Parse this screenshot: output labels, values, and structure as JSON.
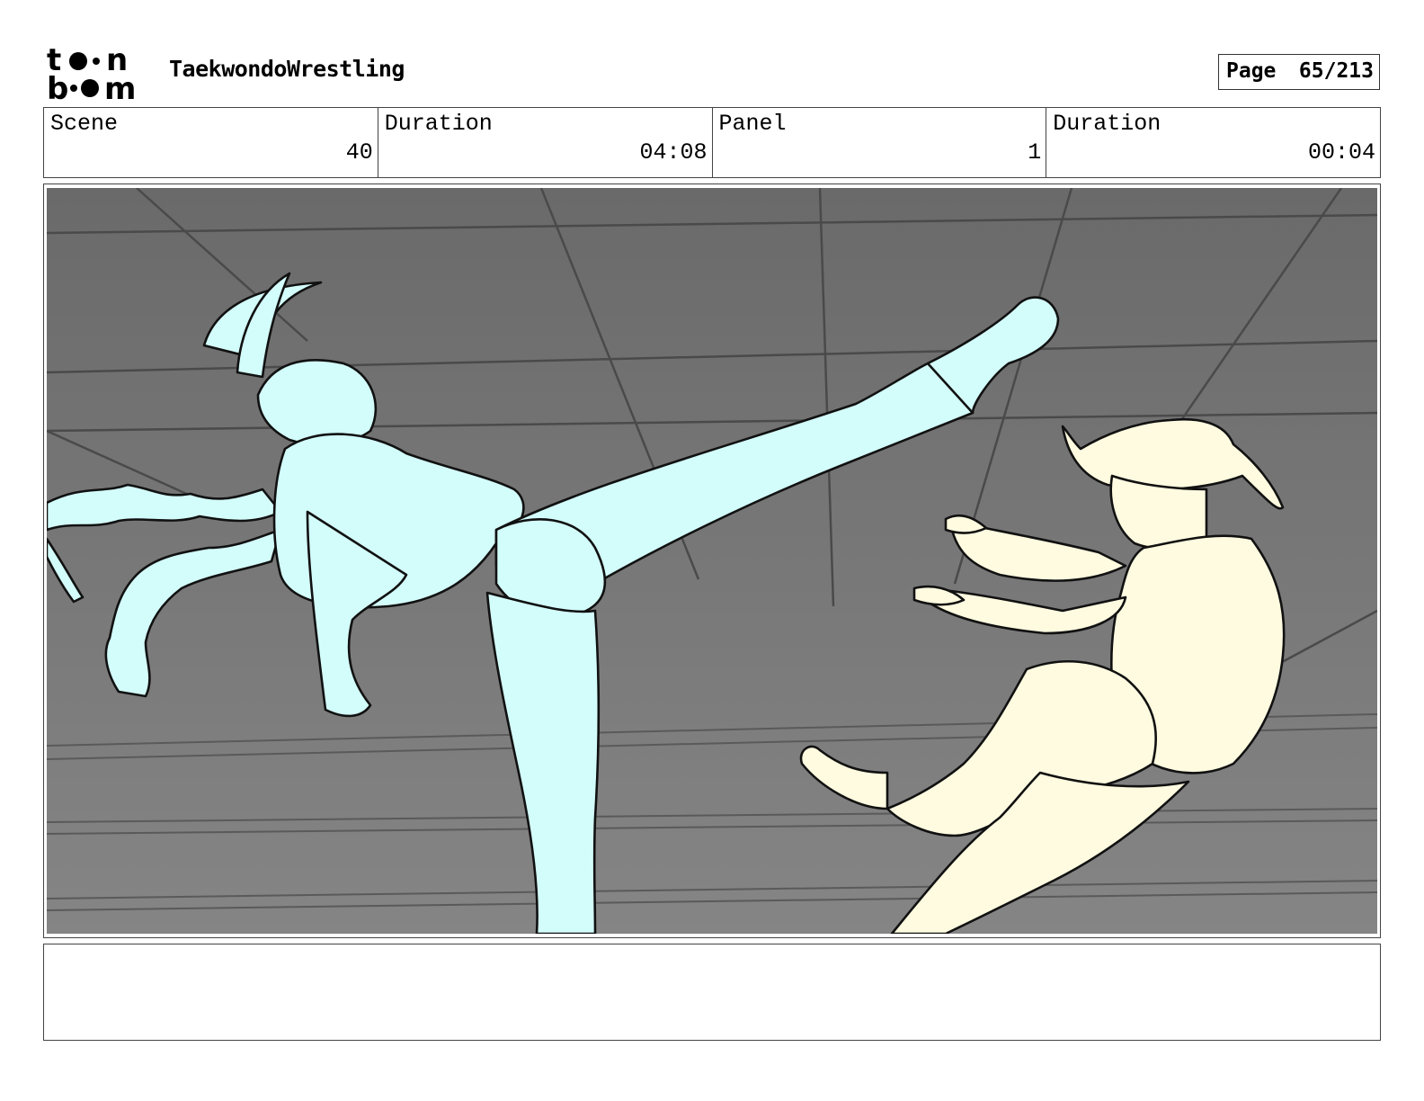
{
  "header": {
    "logo_text": "toon boom",
    "project_title": "TaekwondoWrestling",
    "page_label": "Page",
    "page_value": "65/213"
  },
  "info": {
    "scene_label": "Scene",
    "scene_value": "40",
    "scene_duration_label": "Duration",
    "scene_duration_value": "04:08",
    "panel_label": "Panel",
    "panel_value": "1",
    "panel_duration_label": "Duration",
    "panel_duration_value": "00:04"
  },
  "colors": {
    "background_gray": "#7a7a7a",
    "kicker_fill": "#d3fdfb",
    "opponent_fill": "#fffbe0",
    "line": "#111111",
    "frame": "#444444"
  },
  "notes": {
    "text": ""
  }
}
